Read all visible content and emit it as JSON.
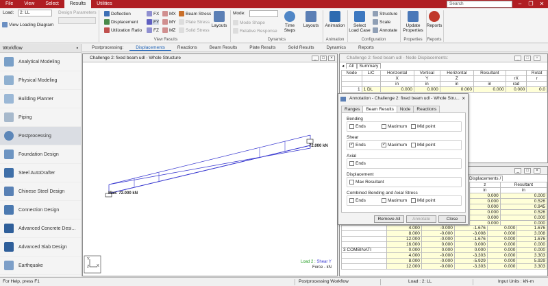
{
  "menubar": {
    "tabs": [
      "File",
      "View",
      "Select",
      "Results",
      "Utilities"
    ],
    "active_tab": "Results",
    "search_placeholder": "Search",
    "window_controls": [
      "minimize",
      "restore",
      "close"
    ]
  },
  "ribbon": {
    "load_label": "Load:",
    "load_value": "2: LL",
    "view_loading_diagram": "View Loading Diagram",
    "design_parameters_label": "Design Parameters",
    "view_results": {
      "deflection": "Deflection",
      "displacement": "Displacement",
      "utilization_ratio": "Utilization Ratio",
      "fx": "FX",
      "fy": "FY",
      "fz": "FZ",
      "mx": "MX",
      "my": "MY",
      "mz": "MZ",
      "beam_stress": "Beam Stress",
      "plate_stress": "Plate Stress",
      "solid_stress": "Solid Stress",
      "layouts": "Layouts",
      "group_label": "View Results"
    },
    "dynamics": {
      "mode_label": "Mode:",
      "mode_shape": "Mode Shape",
      "relative_response": "Relative Response",
      "time_steps": "Time Steps",
      "layouts": "Layouts",
      "group_label": "Dynamics"
    },
    "animation": {
      "label": "Animation",
      "group_label": "Animation"
    },
    "configuration": {
      "select_load_case": "Select Load Case",
      "structure": "Structure",
      "scale": "Scale",
      "annotate": "Annotate",
      "group_label": "Configuration"
    },
    "properties": {
      "update": "Update Properties",
      "group_label": "Properties"
    },
    "reports": {
      "label": "Reports",
      "group_label": "Reports"
    }
  },
  "workflow": {
    "title": "Workflow",
    "items": [
      "Analytical Modeling",
      "Physical Modeling",
      "Building Planner",
      "Piping",
      "Postprocessing",
      "Foundation Design",
      "Steel AutoDrafter",
      "Chinese Steel Design",
      "Connection Design",
      "Advanced Concrete Desi...",
      "Advanced Slab Design",
      "Earthquake"
    ],
    "active": "Postprocessing"
  },
  "postprocessing_tabs": {
    "label": "Postprocessing:",
    "tabs": [
      "Displacements",
      "Reactions",
      "Beam Results",
      "Plate Results",
      "Solid Results",
      "Dynamics",
      "Reports"
    ],
    "active": "Displacements"
  },
  "structure_window": {
    "title": "Challenge 2: fixed beam udl - Whole Structure",
    "label_right": "72.000 kN",
    "label_left": "Max: 72.000 kN",
    "legend_load": "Load 2 :",
    "legend_shear": "Shear Y",
    "legend_force": "Force - kN",
    "axis_y": "Y",
    "axis_x": "X",
    "axis_z": "Z"
  },
  "node_displacements": {
    "title": "Challenge 2: fixed beam udl - Node Displacements:",
    "tabs": [
      "All",
      "Summary"
    ],
    "headers_1": [
      "Node",
      "L/C",
      "Horizontal",
      "Vertical",
      "Horizontal",
      "Resultant",
      "",
      "Rotat"
    ],
    "headers_2": [
      "",
      "",
      "X",
      "Y",
      "Z",
      "",
      "rX",
      "r"
    ],
    "headers_3": [
      "",
      "",
      "in",
      "in",
      "in",
      "in",
      "rad",
      ""
    ],
    "row": [
      "1",
      "1 DL",
      "0.000",
      "0.000",
      "0.000",
      "0.000",
      "0.000",
      "0.0"
    ]
  },
  "beam_displacements": {
    "tab_label": "Displacements",
    "head_z": "z",
    "head_z_unit": "in",
    "head_res": "Resultant",
    "head_res_unit": "in",
    "upper_rows": [
      [
        "0.000",
        "0.000"
      ],
      [
        "0.000",
        "0.526"
      ],
      [
        "0.000",
        "0.945"
      ],
      [
        "0.000",
        "0.526"
      ],
      [
        "0.000",
        "0.000"
      ],
      [
        "0.000",
        "0.000"
      ]
    ],
    "rows": [
      [
        "",
        "4.000",
        "-0.000",
        "-1.676",
        "0.000",
        "1.676"
      ],
      [
        "",
        "8.000",
        "-0.000",
        "-3.008",
        "0.000",
        "3.008"
      ],
      [
        "",
        "12.000",
        "-0.000",
        "-1.676",
        "0.000",
        "1.676"
      ],
      [
        "",
        "16.000",
        "0.000",
        "0.000",
        "0.000",
        "0.000"
      ],
      [
        "3 COMBINATI",
        "0.000",
        "0.000",
        "0.000",
        "0.000",
        "0.000"
      ],
      [
        "",
        "4.000",
        "-0.000",
        "-3.303",
        "0.000",
        "3.303"
      ],
      [
        "",
        "8.000",
        "-0.000",
        "-5.929",
        "0.000",
        "5.929"
      ],
      [
        "",
        "12.000",
        "-0.000",
        "-3.303",
        "0.000",
        "3.303"
      ]
    ]
  },
  "annotation_dialog": {
    "title": "Annotation - Challenge 2: fixed beam udl - Whole Stru...",
    "tabs": [
      "Ranges",
      "Beam Results",
      "Node",
      "Reactions"
    ],
    "active_tab": "Beam Results",
    "groups": [
      {
        "title": "Bending",
        "options": [
          {
            "label": "Ends",
            "checked": false
          },
          {
            "label": "Maximum",
            "checked": false
          },
          {
            "label": "Mid point",
            "checked": false
          }
        ]
      },
      {
        "title": "Shear",
        "options": [
          {
            "label": "Ends",
            "checked": true
          },
          {
            "label": "Maximum",
            "checked": true
          },
          {
            "label": "Mid point",
            "checked": false
          }
        ]
      },
      {
        "title": "Axial",
        "options": [
          {
            "label": "Ends",
            "checked": false
          }
        ]
      },
      {
        "title": "Displacement",
        "options": [
          {
            "label": "Max Resultant",
            "checked": false
          }
        ]
      },
      {
        "title": "Combined Bending and Axial Stress",
        "options": [
          {
            "label": "Ends",
            "checked": false
          },
          {
            "label": "Maximum",
            "checked": false
          },
          {
            "label": "Mid point",
            "checked": false
          }
        ]
      }
    ],
    "buttons": {
      "remove_all": "Remove All",
      "annotate": "Annotate",
      "close": "Close"
    }
  },
  "statusbar": {
    "help": "For Help, press F1",
    "workflow": "Postprocessing Workflow",
    "load": "Load : 2: LL",
    "units": "Input Units : kN-m"
  },
  "colors": {
    "brand_red": "#b01e23",
    "diagram_blue": "#3a3ad0",
    "legend_green": "#1a9a1a",
    "accent_blue": "#1a5fb4"
  }
}
